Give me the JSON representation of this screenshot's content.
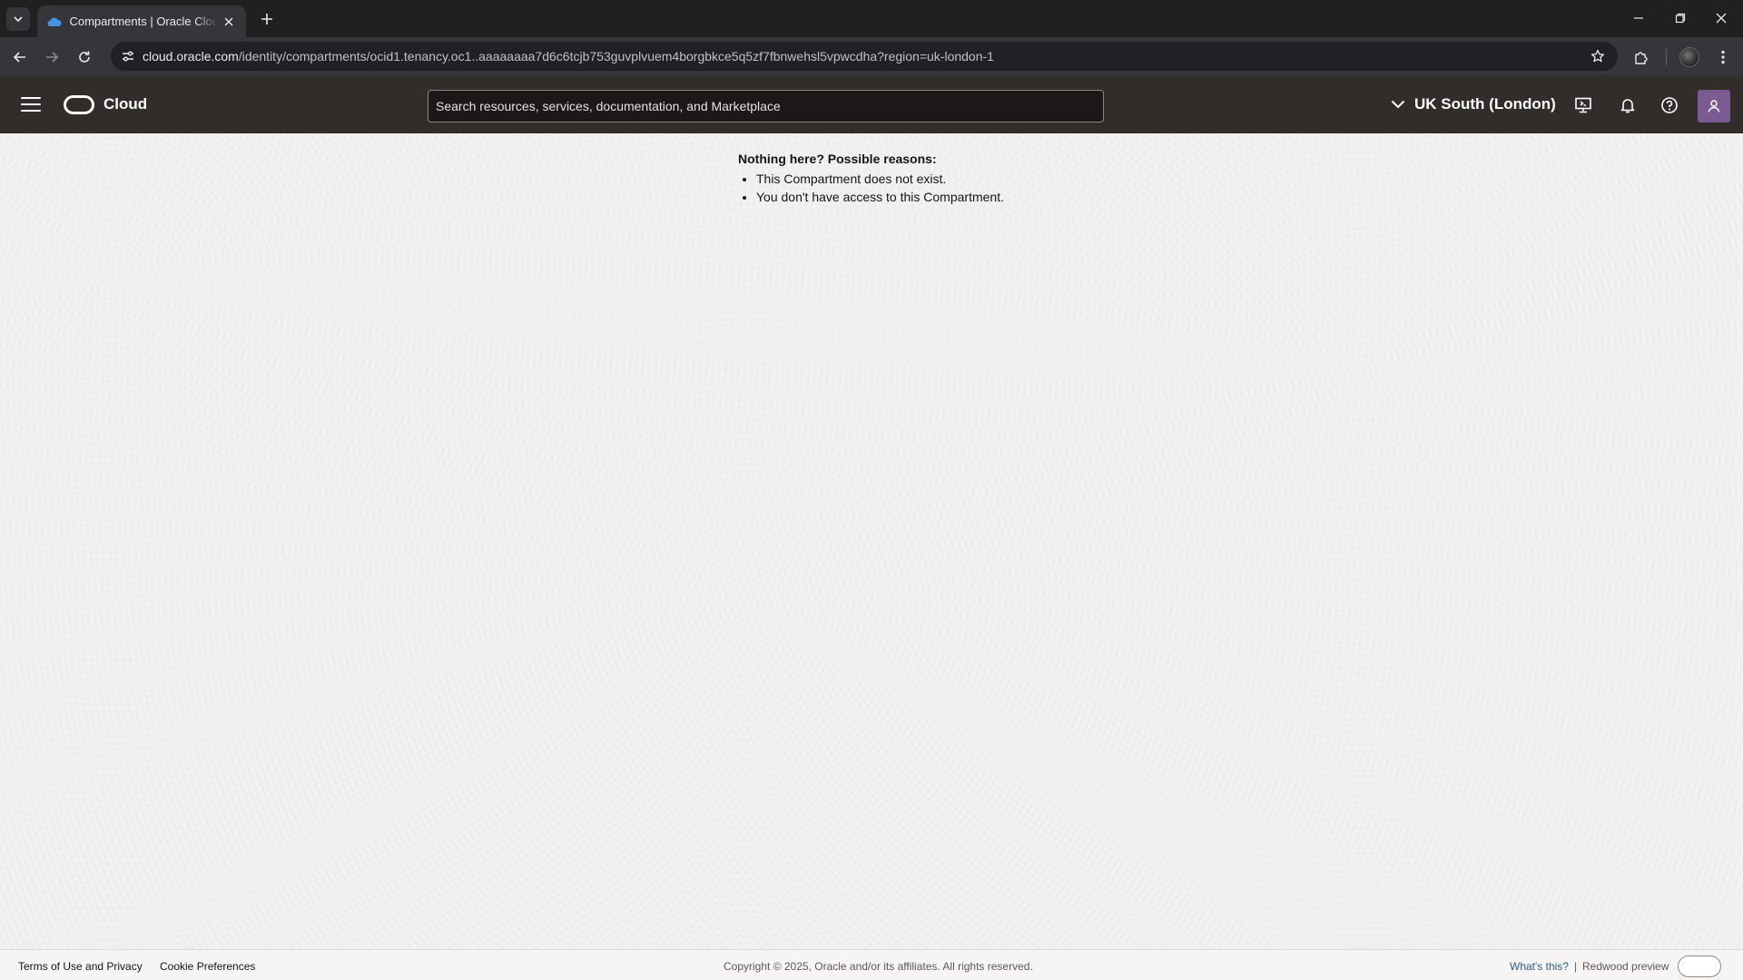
{
  "browser": {
    "tab_title": "Compartments | Oracle Cloud Infrastructure",
    "url_host": "cloud.oracle.com",
    "url_path": "/identity/compartments/ocid1.tenancy.oc1..aaaaaaaa7d6c6tcjb753guvplvuem4borgbkce5q5zf7fbnwehsl5vpwcdha?region=uk-london-1"
  },
  "header": {
    "brand": "Cloud",
    "search_placeholder": "Search resources, services, documentation, and Marketplace",
    "region": "UK South (London)"
  },
  "content": {
    "heading": "Nothing here? Possible reasons:",
    "reasons": [
      "This Compartment does not exist.",
      "You don't have access to this Compartment."
    ]
  },
  "footer": {
    "terms": "Terms of Use and Privacy",
    "cookies": "Cookie Preferences",
    "copyright": "Copyright © 2025, Oracle and/or its affiliates. All rights reserved.",
    "whats_this": "What's this?",
    "separator": "|",
    "redwood": "Redwood preview"
  },
  "colors": {
    "header_bg": "#312d2a",
    "avatar_bg": "#7a5a91",
    "link": "#2a5d8f"
  }
}
